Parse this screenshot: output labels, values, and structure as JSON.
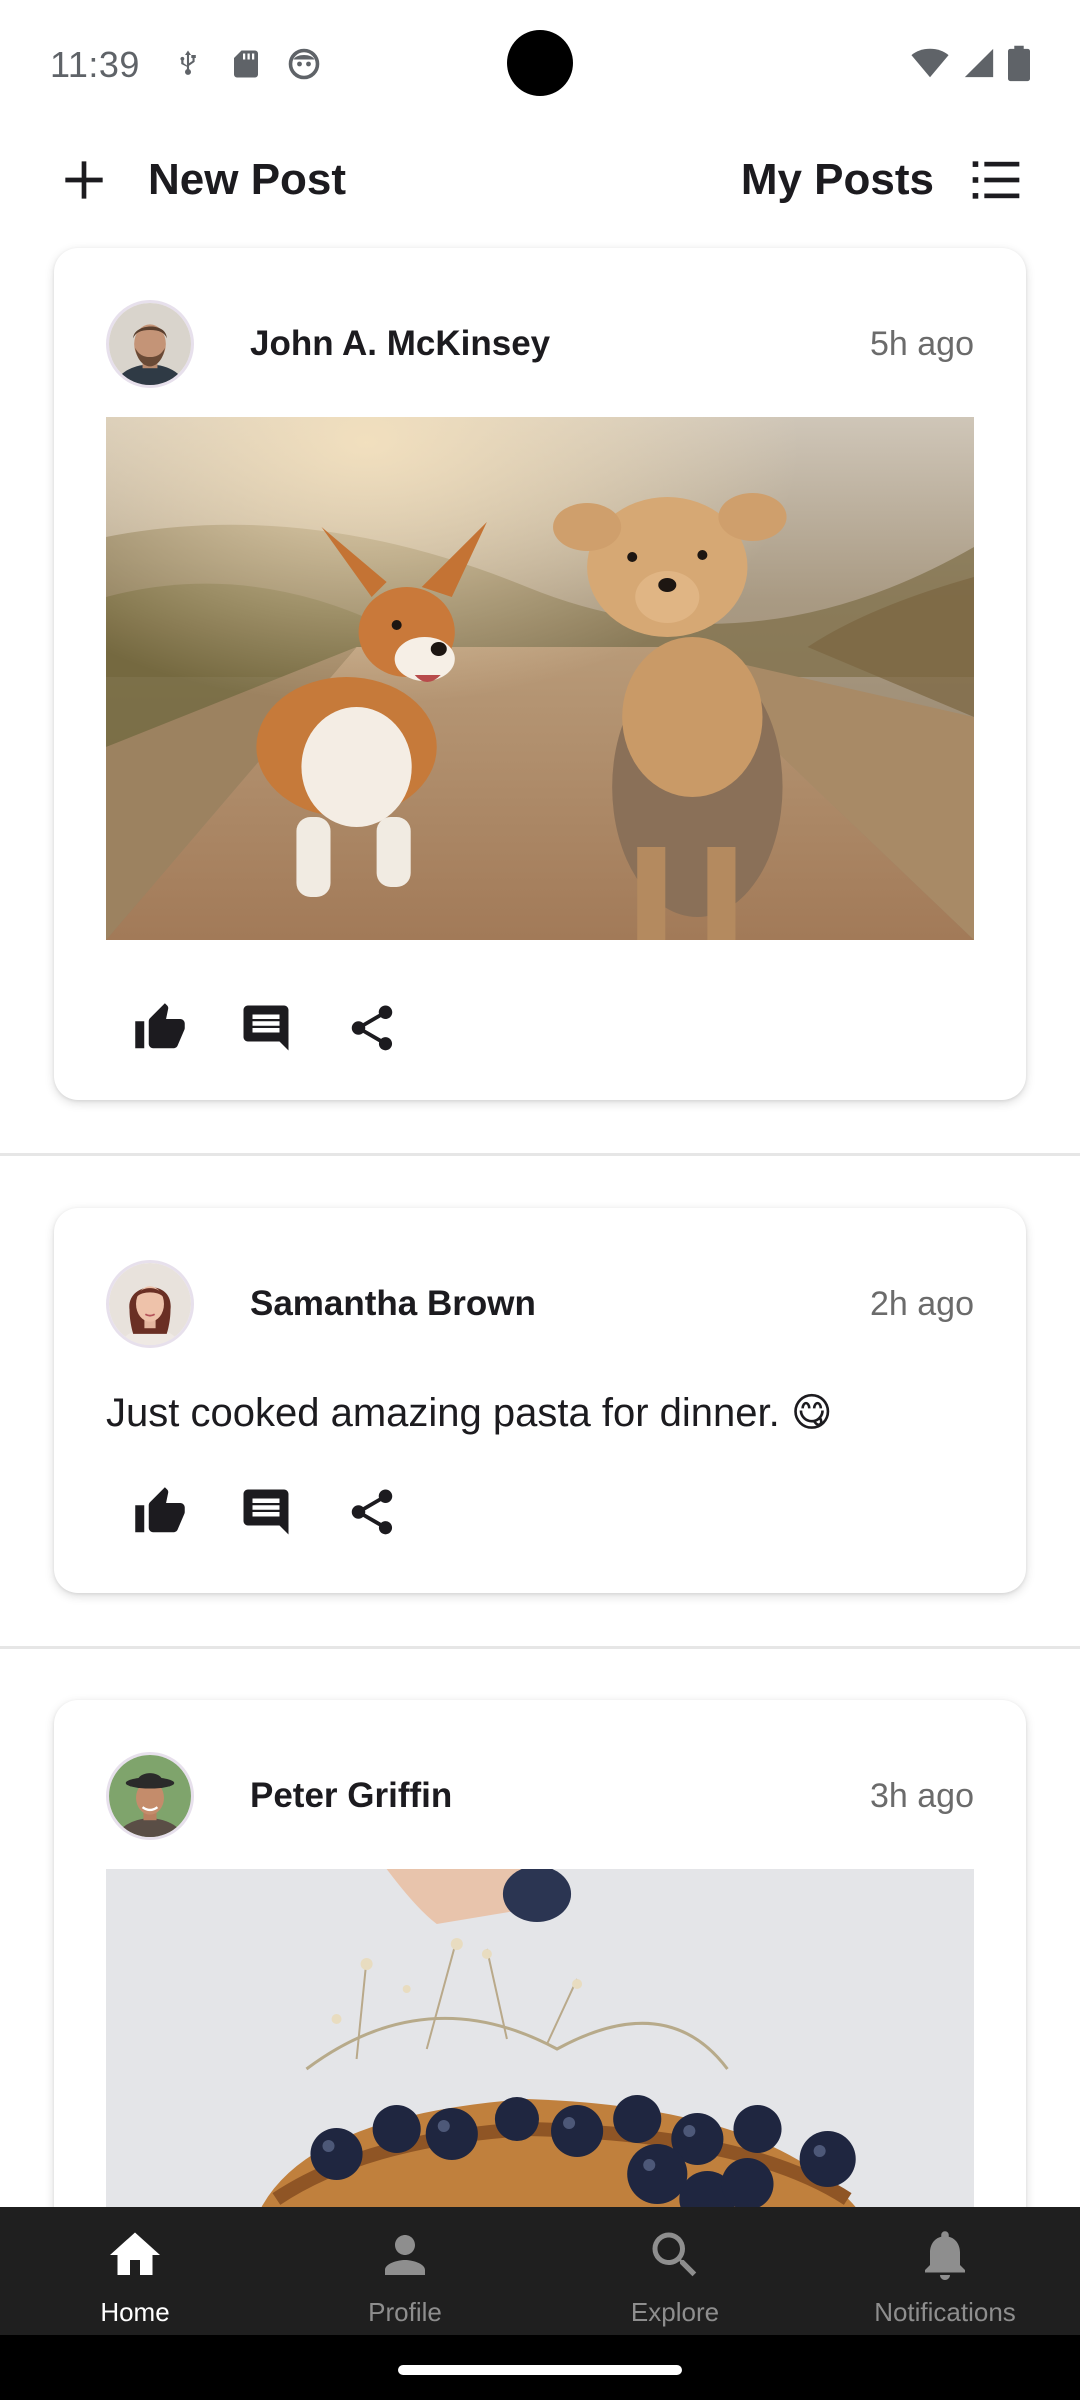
{
  "status_bar": {
    "time": "11:39"
  },
  "top_bar": {
    "new_post_label": "New Post",
    "my_posts_label": "My Posts"
  },
  "posts": [
    {
      "author": "John A. McKinsey",
      "time": "5h ago",
      "text": "",
      "has_image": true,
      "image_subject": "two dogs running on a dirt road"
    },
    {
      "author": "Samantha Brown",
      "time": "2h ago",
      "text": "Just cooked amazing pasta for dinner. 😋",
      "has_image": false
    },
    {
      "author": "Peter Griffin",
      "time": "3h ago",
      "text": "",
      "has_image": true,
      "image_subject": "cake topped with blueberries"
    }
  ],
  "bottom_nav": {
    "items": [
      {
        "label": "Home",
        "icon": "home-icon",
        "active": true
      },
      {
        "label": "Profile",
        "icon": "person-icon",
        "active": false
      },
      {
        "label": "Explore",
        "icon": "search-icon",
        "active": false
      },
      {
        "label": "Notifications",
        "icon": "bell-icon",
        "active": false
      }
    ]
  },
  "colors": {
    "nav_background": "#1f1f1f",
    "nav_active": "#ffffff",
    "nav_inactive": "#8e8e8e",
    "card_background": "#ffffff",
    "text_primary": "#1c1b1f",
    "text_secondary": "#6b6b6b"
  }
}
